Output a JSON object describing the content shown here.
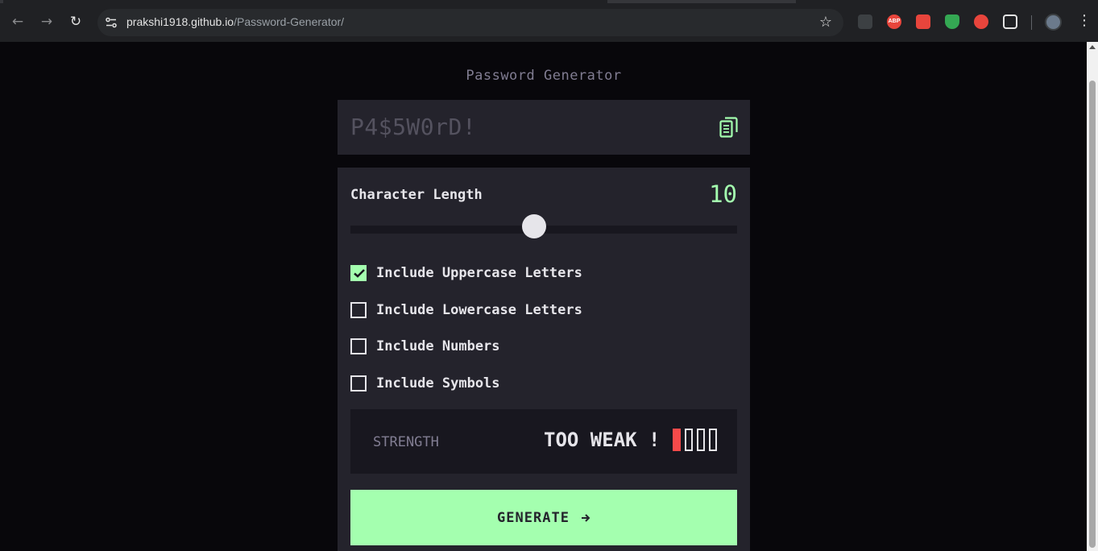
{
  "browser": {
    "url_host": "prakshi1918.github.io",
    "url_path": "/Password-Generator/",
    "back_icon": "arrow-left-icon",
    "forward_icon": "arrow-right-icon",
    "reload_icon": "reload-icon",
    "bookmark_icon": "star-icon",
    "extensions": [
      {
        "name": "extension-generic-icon",
        "color": "#e3e3e3"
      },
      {
        "name": "adblock-plus-icon",
        "color": "#e8453c"
      },
      {
        "name": "extension-red-icon",
        "color": "#e8453c"
      },
      {
        "name": "shield-green-icon",
        "color": "#34a853"
      },
      {
        "name": "extension-badge-icon",
        "color": "#e8453c"
      },
      {
        "name": "puzzle-icon",
        "color": "#e3e3e3"
      }
    ],
    "adblock_text": "ABP"
  },
  "app": {
    "title": "Password Generator",
    "password": "P4$5W0rD!",
    "length_label": "Character Length",
    "length_value": "10",
    "slider_fraction": 0.475,
    "options": [
      {
        "label": "Include Uppercase Letters",
        "checked": true
      },
      {
        "label": "Include Lowercase Letters",
        "checked": false
      },
      {
        "label": "Include Numbers",
        "checked": false
      },
      {
        "label": "Include Symbols",
        "checked": false
      }
    ],
    "strength_label": "STRENGTH",
    "strength_value": "TOO WEAK !",
    "strength_bars_filled": 1,
    "strength_bars_total": 4,
    "generate_label": "GENERATE",
    "colors": {
      "accent": "#a4ffaf",
      "danger": "#f64a4a",
      "panel": "#24232c",
      "background": "#08070b"
    }
  }
}
